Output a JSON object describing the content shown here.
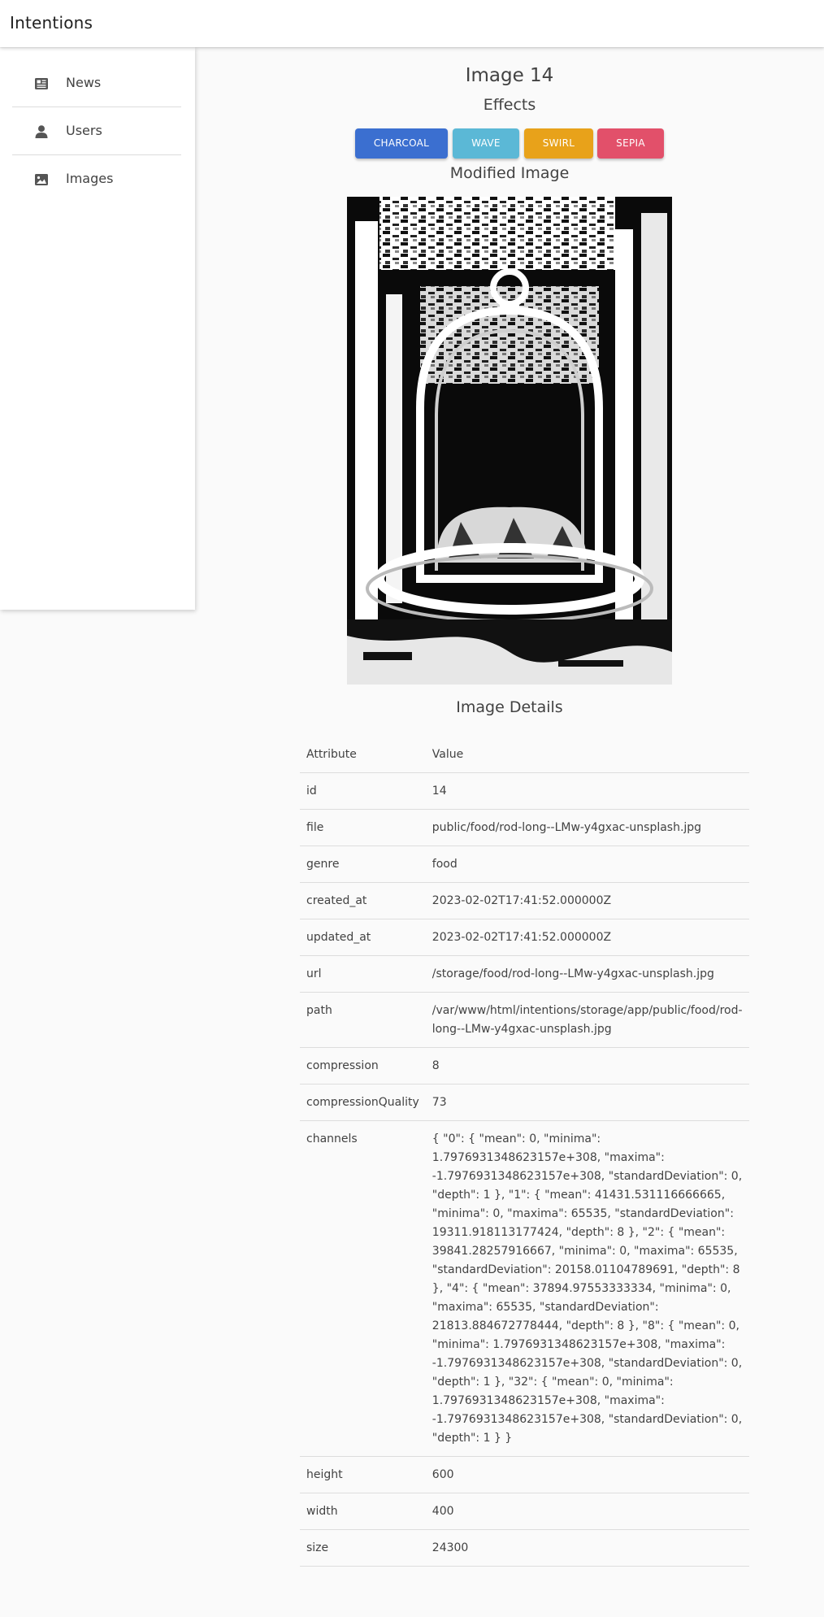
{
  "app": {
    "title": "Intentions"
  },
  "sidebar": {
    "items": [
      {
        "label": "News",
        "icon": "newspaper-icon"
      },
      {
        "label": "Users",
        "icon": "user-icon"
      },
      {
        "label": "Images",
        "icon": "image-icon"
      }
    ]
  },
  "page": {
    "title": "Image 14",
    "effects_heading": "Effects",
    "modified_heading": "Modified Image",
    "details_heading": "Image Details"
  },
  "effects": [
    {
      "label": "CHARCOAL",
      "color": "#3b6fd0"
    },
    {
      "label": "WAVE",
      "color": "#5bb8d6"
    },
    {
      "label": "SWIRL",
      "color": "#e8a21a"
    },
    {
      "label": "SEPIA",
      "color": "#e2506a"
    }
  ],
  "image": {
    "effect": "charcoal"
  },
  "table": {
    "header": {
      "attribute": "Attribute",
      "value": "Value"
    },
    "rows": [
      {
        "attr": "id",
        "value": "14"
      },
      {
        "attr": "file",
        "value": "public/food/rod-long--LMw-y4gxac-unsplash.jpg"
      },
      {
        "attr": "genre",
        "value": "food"
      },
      {
        "attr": "created_at",
        "value": "2023-02-02T17:41:52.000000Z"
      },
      {
        "attr": "updated_at",
        "value": "2023-02-02T17:41:52.000000Z"
      },
      {
        "attr": "url",
        "value": "/storage/food/rod-long--LMw-y4gxac-unsplash.jpg"
      },
      {
        "attr": "path",
        "value": "/var/www/html/intentions/storage/app/public/food/rod-long--LMw-y4gxac-unsplash.jpg"
      },
      {
        "attr": "compression",
        "value": "8"
      },
      {
        "attr": "compressionQuality",
        "value": "73"
      },
      {
        "attr": "channels",
        "value": "{ \"0\": { \"mean\": 0, \"minima\": 1.7976931348623157e+308, \"maxima\": -1.7976931348623157e+308, \"standardDeviation\": 0, \"depth\": 1 }, \"1\": { \"mean\": 41431.531116666665, \"minima\": 0, \"maxima\": 65535, \"standardDeviation\": 19311.918113177424, \"depth\": 8 }, \"2\": { \"mean\": 39841.28257916667, \"minima\": 0, \"maxima\": 65535, \"standardDeviation\": 20158.01104789691, \"depth\": 8 }, \"4\": { \"mean\": 37894.97553333334, \"minima\": 0, \"maxima\": 65535, \"standardDeviation\": 21813.884672778444, \"depth\": 8 }, \"8\": { \"mean\": 0, \"minima\": 1.7976931348623157e+308, \"maxima\": -1.7976931348623157e+308, \"standardDeviation\": 0, \"depth\": 1 }, \"32\": { \"mean\": 0, \"minima\": 1.7976931348623157e+308, \"maxima\": -1.7976931348623157e+308, \"standardDeviation\": 0, \"depth\": 1 } }"
      },
      {
        "attr": "height",
        "value": "600"
      },
      {
        "attr": "width",
        "value": "400"
      },
      {
        "attr": "size",
        "value": "24300"
      }
    ]
  }
}
